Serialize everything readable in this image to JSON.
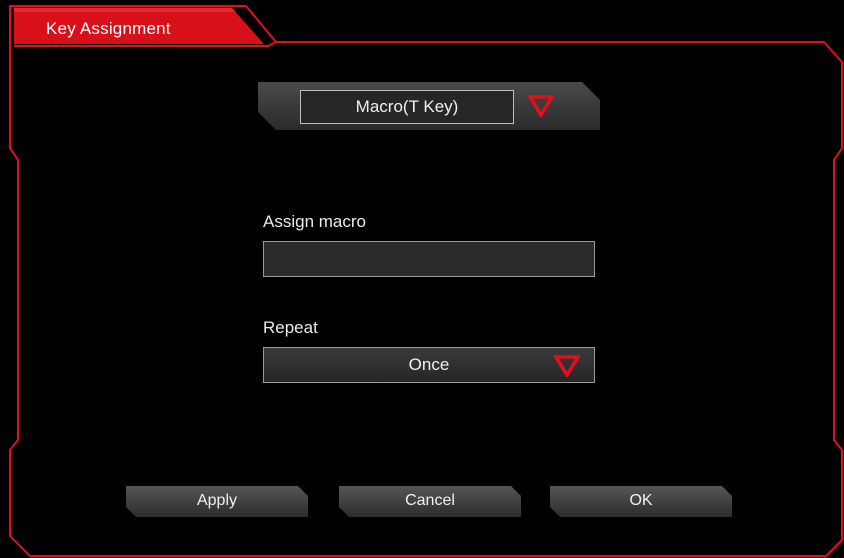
{
  "window": {
    "title": "Key Assignment"
  },
  "assignment_type": {
    "selected": "Macro(T Key)",
    "arrow_icon": "red-triangle-down"
  },
  "assign_macro": {
    "label": "Assign macro",
    "value": ""
  },
  "repeat": {
    "label": "Repeat",
    "selected": "Once",
    "arrow_icon": "red-triangle-down"
  },
  "buttons": {
    "apply": "Apply",
    "cancel": "Cancel",
    "ok": "OK"
  },
  "colors": {
    "accent": "#e3101c",
    "background": "#000000",
    "panel": "#333333"
  }
}
